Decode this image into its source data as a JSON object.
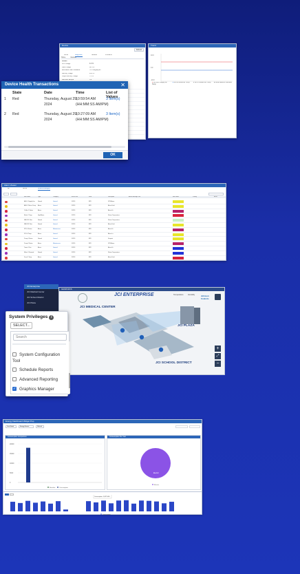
{
  "panel1": {
    "main_window": {
      "title": "Device",
      "tabs": [
        "Home",
        "Devices"
      ],
      "subtabs": [
        "Focus",
        "Diagnostic",
        "Network",
        "Problems"
      ],
      "right_button": "Refresh",
      "section_label": "Details",
      "rows": [
        {
          "label": "CPU Usage",
          "value": "4.0 %"
        },
        {
          "label": "Flash Usage",
          "value": "62.3 %"
        },
        {
          "label": "Estimated Flash Available",
          "value": "71.0 Megabytes"
        },
        {
          "label": "Memory Usage",
          "value": "24.2 %"
        },
        {
          "label": "Object Memory Usage",
          "value": "7.1 %"
        },
        {
          "label": "Last Idle Sample",
          "value": "5:0"
        }
      ]
    },
    "chart_window": {
      "title": "Trend",
      "y_ticks": [
        "10.0",
        "0.0",
        "-10.0"
      ],
      "legend": [
        {
          "label": "AHU005 Supply-Air Temp",
          "color": "#e8434c"
        },
        {
          "label": "AHU0 Mixed-Air Temp",
          "color": "#2b6fd1"
        },
        {
          "label": "AHU Outdoor-Air Temp",
          "color": "#777777"
        },
        {
          "label": "BLDG Electric Demand",
          "color": "#444444"
        }
      ]
    },
    "dialog": {
      "title": "Device Health Transactions",
      "headers": [
        "State",
        "Date",
        "Time",
        "List of Values"
      ],
      "rows": [
        {
          "num": "1",
          "state": "Red",
          "date1": "Thursday, August 29,",
          "date2": "2024",
          "time1": "10:59:54 AM",
          "time2": "(HH:MM:SS AM/PM)",
          "values": "3 Item(s)"
        },
        {
          "num": "2",
          "state": "Red",
          "date1": "Thursday, August 29,",
          "date2": "2024",
          "time1": "10:27:09 AM",
          "time2": "(HH:MM:SS AM/PM)",
          "values": "3 Item(s)"
        }
      ],
      "ok": "OK"
    }
  },
  "panel2": {
    "title": "Alarm Viewer",
    "tabs": [
      "All",
      "Active",
      "Unacknowledged"
    ],
    "columns": [
      "",
      "",
      "",
      "Item Name",
      "Type",
      "Category",
      "Event Date",
      "State",
      "Description",
      "Alarm Message Text",
      "Item Notes",
      "Priority",
      "Action"
    ],
    "rows": [
      {
        "item": "AHU-1 Supply Fan",
        "type": "Normal",
        "cat": "General",
        "date": "9/2/24",
        "state": "BPK",
        "desc": "DPS Alarm",
        "color": "#e8e52a"
      },
      {
        "item": "AHU-2 Return Temp",
        "type": "Alarm",
        "cat": "General",
        "date": "9/2/24",
        "state": "BPK",
        "desc": "Alarm Fault",
        "color": "#e8e52a"
      },
      {
        "item": "Chiller-1 Status",
        "type": "Alarm",
        "cat": "General",
        "date": "9/2/24",
        "state": "BPK",
        "desc": "Alarm Hi",
        "color": "#b6226a"
      },
      {
        "item": "Boiler-2 Temp",
        "type": "High Alarm",
        "cat": "General",
        "date": "9/2/24",
        "state": "BPK",
        "desc": "Return Temperature",
        "color": "#d8233e"
      },
      {
        "item": "VAV-101 Flow",
        "type": "Normal",
        "cat": "General",
        "date": "9/2/24",
        "state": "BPK",
        "desc": "Return Temperature",
        "color": "#c8f0c4"
      },
      {
        "item": "VAV-102 Flow",
        "type": "Normal",
        "cat": "General",
        "date": "9/2/24",
        "state": "BPK",
        "desc": "Alarm Fault",
        "color": "#e8e52a"
      },
      {
        "item": "RTU-3 Status",
        "type": "Alarm",
        "cat": "Maintenance",
        "date": "9/2/24",
        "state": "BPK",
        "desc": "Alarm Hi",
        "color": "#b6226a"
      },
      {
        "item": "FCU-4 Temp",
        "type": "Alarm",
        "cat": "General",
        "date": "9/2/24",
        "state": "BPK",
        "desc": "Alarm Lo",
        "color": "#e8e52a"
      },
      {
        "item": "Pump-1 Status",
        "type": "Normal",
        "cat": "General",
        "date": "9/2/24",
        "state": "BPK",
        "desc": "Setpoint",
        "color": "#e8e52a"
      },
      {
        "item": "Pump-2 Status",
        "type": "Alarm",
        "cat": "Maintenance",
        "date": "9/2/24",
        "state": "BPK",
        "desc": "DPS Alarm",
        "color": "#b6226a"
      },
      {
        "item": "Tower-1 Fan",
        "type": "Alarm",
        "cat": "General",
        "date": "9/2/24",
        "state": "BPK",
        "desc": "Alarm Hi",
        "color": "#2233d8"
      },
      {
        "item": "Meter-1 Demand",
        "type": "Normal",
        "cat": "General",
        "date": "9/2/24",
        "state": "BPK",
        "desc": "Return Temperature",
        "color": "#2233d8"
      },
      {
        "item": "Zone-5 Temp",
        "type": "Alarm",
        "cat": "General",
        "date": "9/2/24",
        "state": "BPK",
        "desc": "Alarm Fault",
        "color": "#d8233e"
      }
    ]
  },
  "panel3": {
    "sidebar": [
      "JCI Enterprise",
      "JCI Medical Center",
      "JCI School District",
      "JCI Plaza"
    ],
    "graphic": {
      "tab": "GRAPHICS",
      "title": "JCI ENTERPRISE",
      "labels": [
        "JCI MEDICAL CENTER",
        "JCI PLAZA",
        "JCI SCHOOL DISTRICT"
      ],
      "badges": [
        "Temperature",
        "Humidity"
      ],
      "brand": "Johnson Controls"
    },
    "privileges": {
      "title": "System Privileges",
      "select": "SELECT...",
      "search_placeholder": "Search",
      "items": [
        {
          "label": "System Configuration Tool",
          "checked": false
        },
        {
          "label": "Schedule Reports",
          "checked": false
        },
        {
          "label": "Advanced Reporting",
          "checked": false
        },
        {
          "label": "Graphics Manager",
          "checked": true
        }
      ]
    }
  },
  "panel4": {
    "title": "Energy Dashboard Widget Pop",
    "controls": [
      "Year Month",
      "Energy Source",
      "Refresh"
    ],
    "left_chart": {
      "title": "Consumption Comparison",
      "y_ticks": [
        "20000",
        "15000",
        "10000",
        "5000",
        "0"
      ],
      "legend": [
        "Baseline",
        "Consumption"
      ]
    },
    "pie_chart": {
      "title": "Consumption Per Year",
      "slice_label": "Electric",
      "legend": "Electric"
    },
    "bottom_chart": {
      "title": "Consumption Trend",
      "legend": "Consumption",
      "tooltip": "Consumption: 3,487 kWh"
    }
  },
  "chart_data": [
    {
      "type": "line",
      "title": "",
      "series": [
        {
          "name": "AHU005 Supply-Air Temp",
          "values": [
            4,
            4,
            4,
            4,
            4,
            4,
            4,
            4
          ]
        },
        {
          "name": "AHU0 Mixed-Air Temp",
          "values": [
            -2,
            -2,
            -2,
            -2,
            -2,
            -2,
            -2,
            -2
          ]
        }
      ],
      "ylim": [
        -10,
        10
      ]
    },
    {
      "type": "bar",
      "title": "Consumption Comparison",
      "categories": [
        "1",
        "2"
      ],
      "series": [
        {
          "name": "Baseline",
          "values": [
            0,
            0
          ]
        },
        {
          "name": "Consumption",
          "values": [
            18000,
            0
          ]
        }
      ],
      "ylim": [
        0,
        20000
      ]
    },
    {
      "type": "pie",
      "title": "Consumption Per Year",
      "categories": [
        "Electric"
      ],
      "values": [
        100
      ]
    },
    {
      "type": "bar",
      "title": "Consumption Trend",
      "categories": [
        "1",
        "2",
        "3",
        "4",
        "5",
        "6",
        "7",
        "8",
        "9",
        "10",
        "11",
        "12",
        "13",
        "14",
        "15",
        "16",
        "17",
        "18",
        "19",
        "20",
        "21",
        "22",
        "23",
        "24",
        "25"
      ],
      "series": [
        {
          "name": "Consumption",
          "values": [
            3100,
            2700,
            3400,
            2800,
            3200,
            2500,
            3300,
            600,
            0,
            0,
            3300,
            2900,
            3487,
            2600,
            3500,
            3600,
            2500,
            3500,
            3400,
            3200,
            2600,
            3100,
            0,
            0,
            0
          ]
        }
      ],
      "ylim": [
        0,
        4000
      ]
    }
  ]
}
